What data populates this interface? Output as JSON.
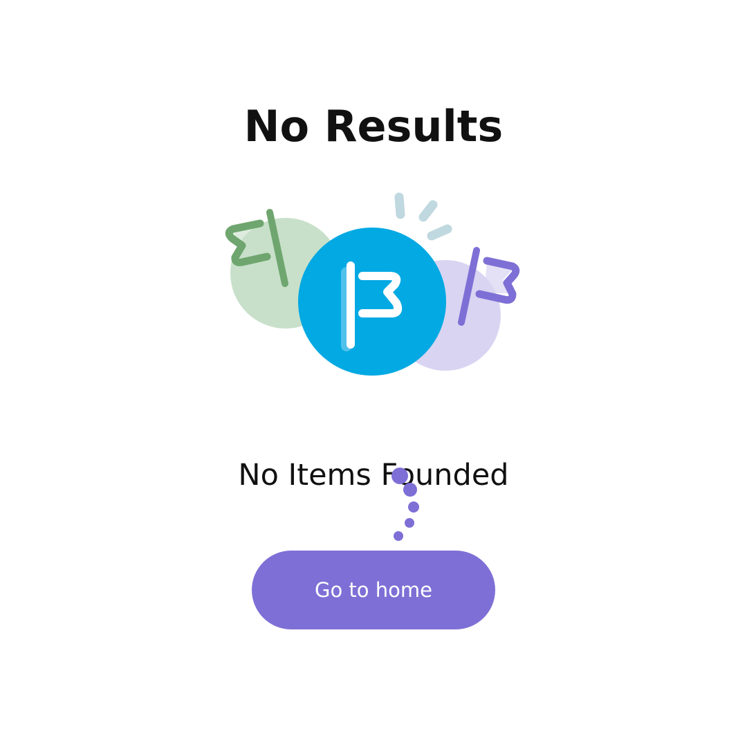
{
  "page": {
    "title": "No Results",
    "message": "No Items Founded"
  },
  "actions": {
    "home_label": "Go to home"
  },
  "colors": {
    "accent": "#7E6FD6",
    "primary_circle": "#03A9E3",
    "green_circle": "#C8E0CA",
    "green_flag": "#6FA66F",
    "purple_circle": "#D9D4F2",
    "purple_flag": "#7E6FD6",
    "sparkle": "#C0D8DF",
    "text": "#111111"
  },
  "illustration": {
    "icons": [
      "green-flag-icon",
      "blue-flag-icon",
      "purple-flag-icon",
      "sparkle-icon"
    ]
  }
}
